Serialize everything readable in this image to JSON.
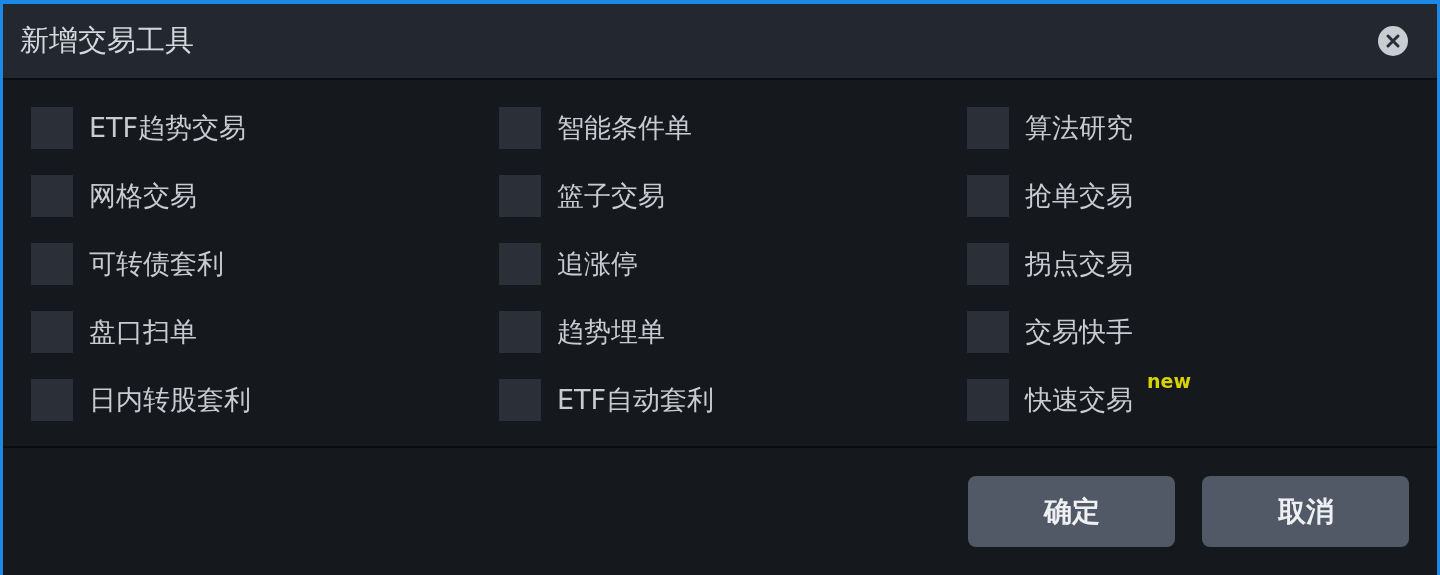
{
  "window": {
    "title": "新增交易工具"
  },
  "tools": [
    {
      "label": "ETF趋势交易",
      "checked": false
    },
    {
      "label": "智能条件单",
      "checked": false
    },
    {
      "label": "算法研究",
      "checked": false
    },
    {
      "label": "网格交易",
      "checked": false
    },
    {
      "label": "篮子交易",
      "checked": false
    },
    {
      "label": "抢单交易",
      "checked": false
    },
    {
      "label": "可转债套利",
      "checked": false
    },
    {
      "label": "追涨停",
      "checked": false
    },
    {
      "label": "拐点交易",
      "checked": false
    },
    {
      "label": "盘口扫单",
      "checked": false
    },
    {
      "label": "趋势埋单",
      "checked": false
    },
    {
      "label": "交易快手",
      "checked": false
    },
    {
      "label": "日内转股套利",
      "checked": false
    },
    {
      "label": "ETF自动套利",
      "checked": false
    },
    {
      "label": "快速交易",
      "checked": false,
      "badge": "new"
    }
  ],
  "buttons": [
    "确定",
    "取消"
  ]
}
